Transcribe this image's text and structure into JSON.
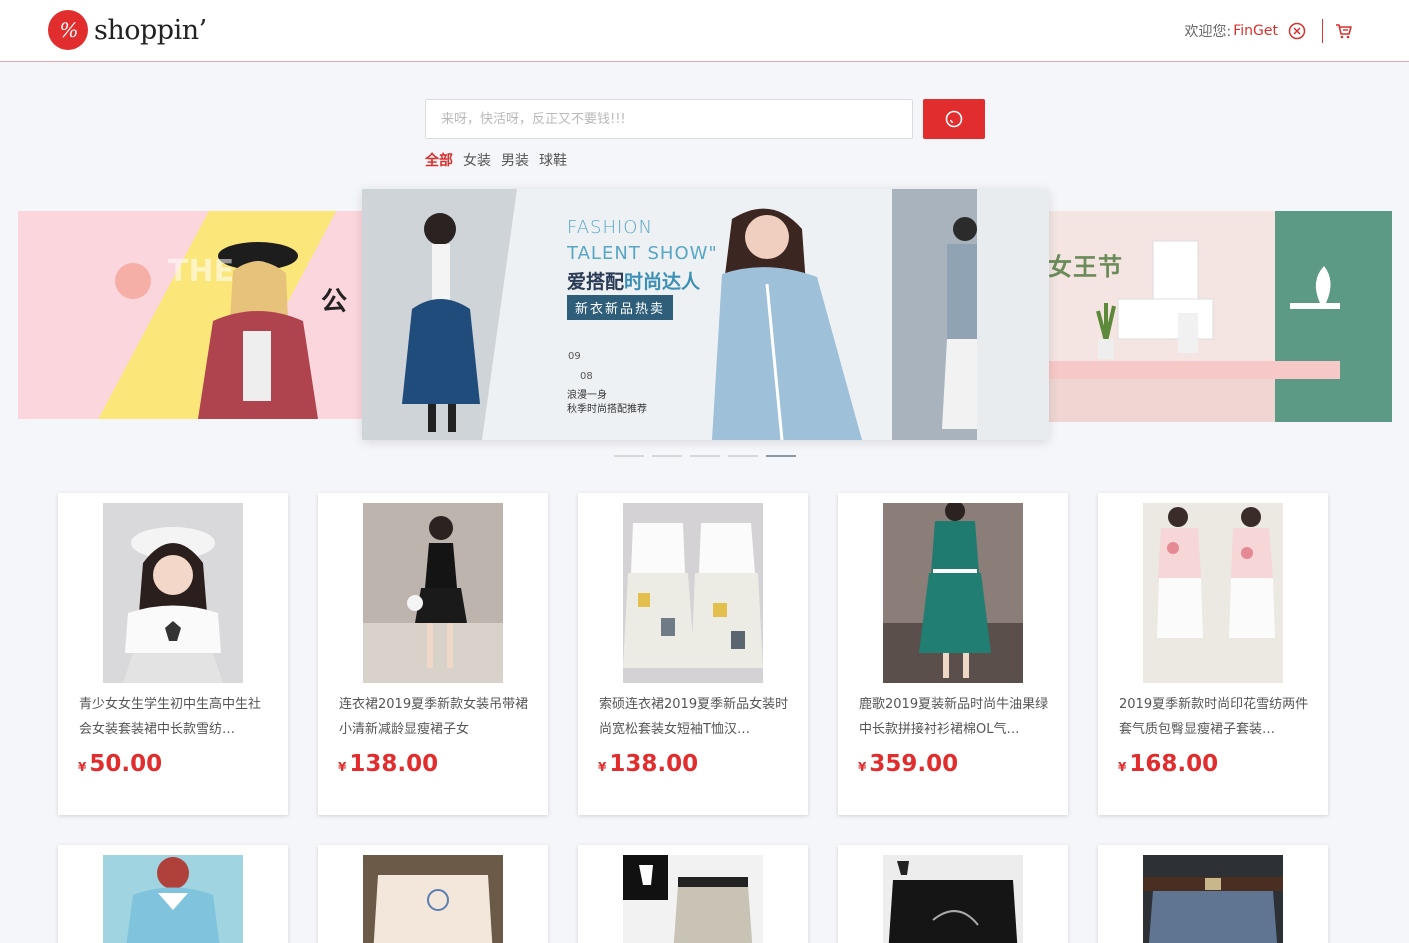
{
  "header": {
    "logo_mark": "%",
    "logo_text": "shoppin’",
    "welcome_label": "欢迎您:",
    "username": "FinGet"
  },
  "search": {
    "placeholder": "来呀，快活呀，反正又不要钱!!!",
    "value": ""
  },
  "categories": [
    "全部",
    "女装",
    "男装",
    "球鞋"
  ],
  "active_category": "全部",
  "carousel": {
    "center": {
      "title_en_1": "FASHION",
      "title_en_2": "TALENT SHOW\"",
      "title_cn_a": "爱搭配",
      "title_cn_b": "时尚达人",
      "tag": "新衣新品热卖",
      "date_1": "09",
      "date_2": "08",
      "sub_1": "浪漫一身",
      "sub_2": "秋季时尚搭配推荐"
    },
    "left_title": "公",
    "right_title": "女王节",
    "dot_count": 5,
    "active_dot": 4
  },
  "colors": {
    "accent": "#e12d2d",
    "header_border": "#e5a3ac",
    "background": "#f5f6fa"
  },
  "products": [
    {
      "name": "青少女女生学生初中生高中生社会女装套装裙中长款雪纺…",
      "currency": "¥",
      "price": "50.00"
    },
    {
      "name": "连衣裙2019夏季新款女装吊带裙小清新减龄显瘦裙子女",
      "currency": "¥",
      "price": "138.00"
    },
    {
      "name": "索硕连衣裙2019夏季新品女装时尚宽松套装女短袖T恤汉…",
      "currency": "¥",
      "price": "138.00"
    },
    {
      "name": "鹿歌2019夏装新品时尚牛油果绿中长款拼接衬衫裙棉OL气…",
      "currency": "¥",
      "price": "359.00"
    },
    {
      "name": "2019夏季新款时尚印花雪纺两件套气质包臀显瘦裙子套装…",
      "currency": "¥",
      "price": "168.00"
    }
  ]
}
